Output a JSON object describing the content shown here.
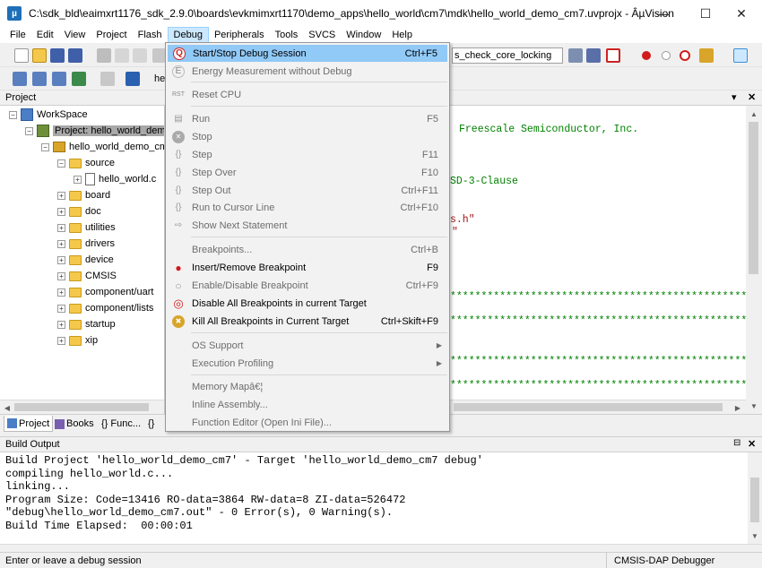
{
  "window": {
    "title": "C:\\sdk_bld\\eaimxrt1176_sdk_2.9.0\\boards\\evkmimxrt1170\\demo_apps\\hello_world\\cm7\\mdk\\hello_world_demo_cm7.uvprojx - ÂµVision",
    "minimize": "—",
    "maximize": "☐",
    "close": "✕"
  },
  "menubar": [
    "File",
    "Edit",
    "View",
    "Project",
    "Flash",
    "Debug",
    "Peripherals",
    "Tools",
    "SVCS",
    "Window",
    "Help"
  ],
  "toolbar": {
    "find_combo": "s_check_core_locking",
    "target_combo": "he"
  },
  "project_panel": {
    "title": "Project",
    "close": "✕",
    "tree": [
      {
        "label": "WorkSpace"
      },
      {
        "label": "Project: hello_world_demo"
      },
      {
        "label": "hello_world_demo_cm"
      },
      {
        "label": "source"
      },
      {
        "label": "hello_world.c"
      },
      {
        "label": "board"
      },
      {
        "label": "doc"
      },
      {
        "label": "utilities"
      },
      {
        "label": "drivers"
      },
      {
        "label": "device"
      },
      {
        "label": "CMSIS"
      },
      {
        "label": "component/uart"
      },
      {
        "label": "component/lists"
      },
      {
        "label": "startup"
      },
      {
        "label": "xip"
      }
    ]
  },
  "panel_tabs": [
    "Project",
    "Books",
    "{} Func...",
    "{}"
  ],
  "editor": {
    "lines": [
      {
        "text": "Freescale Semiconductor, Inc.",
        "color": "#008000"
      },
      {
        "text": "SD-3-Clause",
        "color": "#008000"
      },
      {
        "text": "s.h\"",
        "color": "#a31515"
      },
      {
        "text": "\"",
        "color": "#a31515"
      },
      {
        "text": "*****************************************************",
        "color": "#008000"
      },
      {
        "text": "*****************************************************",
        "color": "#008000"
      },
      {
        "text": "*****************************************************",
        "color": "#008000"
      },
      {
        "text": "*****************************************************",
        "color": "#008000"
      },
      {
        "text": "*****************************************************",
        "color": "#008000"
      }
    ]
  },
  "debug_menu": {
    "items": [
      {
        "label": "Start/Stop Debug Session",
        "key": "Ctrl+F5",
        "icon": "debug-session-icon",
        "glyph": "Q",
        "enabled": true,
        "highlight": true
      },
      {
        "label": "Energy Measurement without Debug",
        "key": "",
        "icon": "energy-measurement-icon",
        "glyph": "E",
        "enabled": false
      },
      {
        "label": "Reset CPU",
        "key": "",
        "icon": "reset-cpu-icon",
        "glyph": "RST",
        "enabled": false
      },
      {
        "label": "Run",
        "key": "F5",
        "icon": "run-icon",
        "glyph": "▤",
        "enabled": false
      },
      {
        "label": "Stop",
        "key": "",
        "icon": "stop-icon",
        "glyph": "✕",
        "enabled": false
      },
      {
        "label": "Step",
        "key": "F11",
        "icon": "step-icon",
        "glyph": "{}",
        "enabled": false
      },
      {
        "label": "Step Over",
        "key": "F10",
        "icon": "step-over-icon",
        "glyph": "{}",
        "enabled": false
      },
      {
        "label": "Step Out",
        "key": "Ctrl+F11",
        "icon": "step-out-icon",
        "glyph": "{}",
        "enabled": false
      },
      {
        "label": "Run to Cursor Line",
        "key": "Ctrl+F10",
        "icon": "run-to-cursor-icon",
        "glyph": "{}",
        "enabled": false
      },
      {
        "label": "Show Next Statement",
        "key": "",
        "icon": "show-next-statement-icon",
        "glyph": "⇨",
        "enabled": false
      },
      {
        "label": "Breakpoints...",
        "key": "Ctrl+B",
        "icon": "",
        "glyph": "",
        "enabled": false
      },
      {
        "label": "Insert/Remove Breakpoint",
        "key": "F9",
        "icon": "breakpoint-icon",
        "glyph": "●",
        "enabled": true
      },
      {
        "label": "Enable/Disable Breakpoint",
        "key": "Ctrl+F9",
        "icon": "enable-breakpoint-icon",
        "glyph": "○",
        "enabled": false
      },
      {
        "label": "Disable All Breakpoints in current Target",
        "key": "",
        "icon": "disable-all-breakpoints-icon",
        "glyph": "◎",
        "enabled": true
      },
      {
        "label": "Kill All Breakpoints in Current Target",
        "key": "Ctrl+Skift+F9",
        "icon": "kill-breakpoints-icon",
        "glyph": "✖",
        "enabled": true
      },
      {
        "label": "OS Support",
        "key": "",
        "icon": "",
        "glyph": "",
        "enabled": false,
        "submenu": true
      },
      {
        "label": "Execution Profiling",
        "key": "",
        "icon": "",
        "glyph": "",
        "enabled": false,
        "submenu": true
      },
      {
        "label": "Memory Mapâ€¦",
        "key": "",
        "icon": "",
        "glyph": "",
        "enabled": false
      },
      {
        "label": "Inline Assembly...",
        "key": "",
        "icon": "",
        "glyph": "",
        "enabled": false
      },
      {
        "label": "Function Editor (Open Ini File)...",
        "key": "",
        "icon": "",
        "glyph": "",
        "enabled": false
      }
    ]
  },
  "build_output": {
    "title": "Build Output",
    "lines": [
      "Build Project 'hello_world_demo_cm7' - Target 'hello_world_demo_cm7 debug'",
      "compiling hello_world.c...",
      "linking...",
      "Program Size: Code=13416 RO-data=3864 RW-data=8 ZI-data=526472",
      "\"debug\\hello_world_demo_cm7.out\" - 0 Error(s), 0 Warning(s).",
      "Build Time Elapsed:  00:00:01"
    ]
  },
  "statusbar": {
    "message": "Enter or leave a debug session",
    "debugger": "CMSIS-DAP Debugger"
  },
  "colors": {
    "menu_highlight": "#91c9f7",
    "breakpoint_red": "#d21b1b",
    "comment_green": "#008000"
  }
}
